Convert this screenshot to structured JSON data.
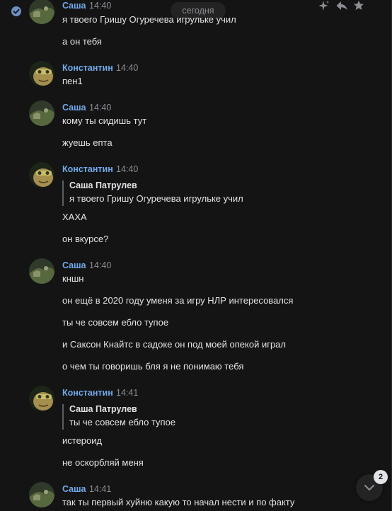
{
  "toolbar": {
    "date_label": "сегодня",
    "unread_count": "2"
  },
  "messages": [
    {
      "author": "Саша",
      "time": "14:40"
    },
    {
      "author": "Константин",
      "time": "14:40"
    },
    {
      "author": "Саша",
      "time": "14:40"
    },
    {
      "author": "Константин",
      "time": "14:40"
    },
    {
      "author": "Саша",
      "time": "14:40"
    },
    {
      "author": "Константин",
      "time": "14:41"
    },
    {
      "author": "Саша",
      "time": "14:41"
    }
  ],
  "lines": [
    "я твоего Гришу Огуречева игрульке учил",
    "а он тебя",
    "пен1",
    "кому ты сидишь тут",
    "жуешь епта",
    "ХАХА",
    "он вкурсе?",
    "кншн",
    "он ещё в 2020 году уменя за игру НЛР интересовался",
    "ты че совсем ебло тупое",
    "и Саксон Кнайтс в садоке он под моей опекой играл",
    "о чем ты говоришь бля я не понимаю тебя",
    "истероид",
    "не оскорбляй меня",
    "так ты первый хуйню какую то начал нести и по факту"
  ],
  "quotes": [
    {
      "author": "Саша Патрулев",
      "text": "я твоего Гришу Огуречева игрульке учил"
    },
    {
      "author": "Саша Патрулев",
      "text": "ты че совсем ебло тупое"
    }
  ],
  "colors": {
    "background": "#141414",
    "author_name": "#71aaeb",
    "text": "#e1e3e6",
    "secondary": "#8b8e93"
  }
}
